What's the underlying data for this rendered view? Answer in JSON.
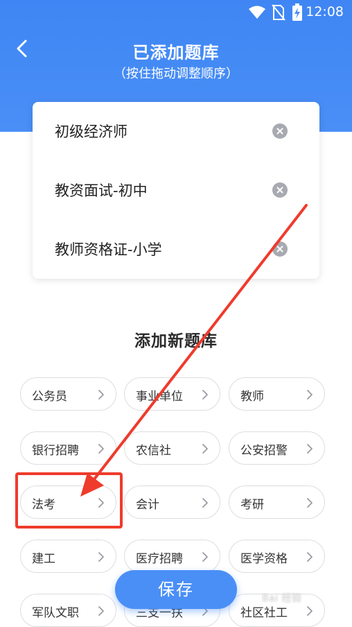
{
  "status_bar": {
    "time": "12:08"
  },
  "header": {
    "title": "已添加题库",
    "subtitle": "（按住拖动调整顺序）"
  },
  "added_banks": [
    {
      "label": "初级经济师"
    },
    {
      "label": "教资面试-初中"
    },
    {
      "label": "教师资格证-小学"
    }
  ],
  "section": {
    "title": "添加新题库"
  },
  "new_banks": [
    {
      "label": "公务员"
    },
    {
      "label": "事业单位"
    },
    {
      "label": "教师"
    },
    {
      "label": "银行招聘"
    },
    {
      "label": "农信社"
    },
    {
      "label": "公安招警"
    },
    {
      "label": "法考"
    },
    {
      "label": "会计"
    },
    {
      "label": "考研"
    },
    {
      "label": "建工"
    },
    {
      "label": "医疗招聘"
    },
    {
      "label": "医学资格"
    },
    {
      "label": "军队文职"
    },
    {
      "label": "三支一扶"
    },
    {
      "label": "社区社工"
    }
  ],
  "actions": {
    "save_label": "保存"
  },
  "watermark": "Bai 经验",
  "colors": {
    "primary": "#4a8ff6",
    "annotation_red": "#ef3b2c",
    "remove_icon": "#a7aab1"
  }
}
